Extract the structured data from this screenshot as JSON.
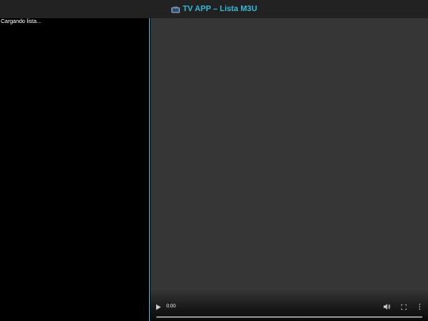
{
  "header": {
    "icon": "tv-icon",
    "title": "TV APP – Lista M3U",
    "accent_color": "#35b8d8",
    "background": "#222222"
  },
  "sidebar": {
    "status_text": "Cargando lista...",
    "border_color": "#35b8d8"
  },
  "player": {
    "background": "#363636",
    "controls": {
      "play_icon": "play-icon",
      "time": "0:00",
      "volume_icon": "volume-icon",
      "fullscreen_icon": "fullscreen-icon",
      "more_icon": "more-options-icon",
      "progress": 0
    }
  }
}
